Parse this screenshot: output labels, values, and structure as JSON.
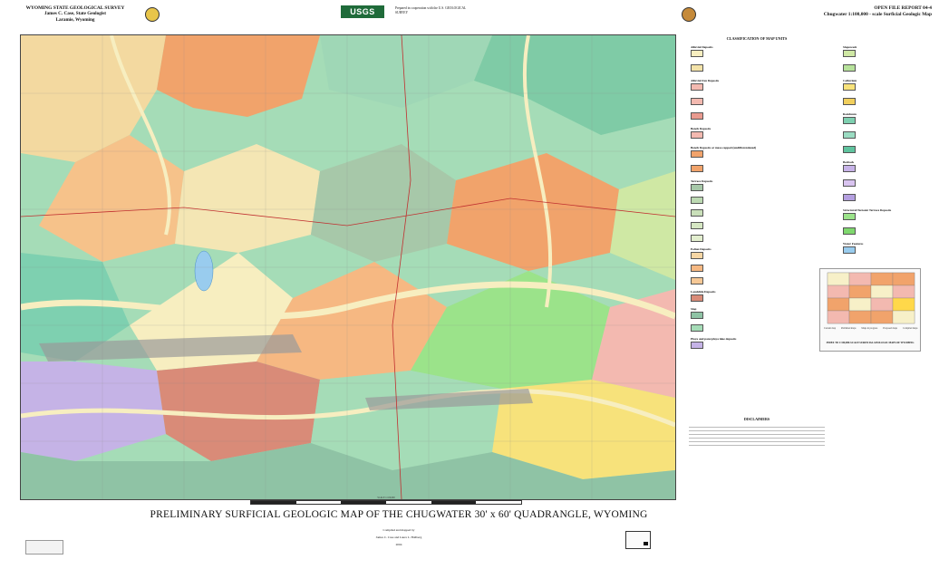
{
  "header": {
    "left_lines": [
      "WYOMING STATE GEOLOGICAL SURVEY",
      "James C. Case, State Geologist",
      "Laramie, Wyoming"
    ],
    "usgs_logo_text": "USGS",
    "coop_text": "Prepared in cooperation with the U.S. GEOLOGICAL SURVEY",
    "right_lines": [
      "OPEN FILE REPORT 04-4",
      "Chugwater 1:100,000 - scale Surficial Geologic Map"
    ]
  },
  "legend": {
    "title": "CLASSIFICATION OF MAP UNITS",
    "sections_left": [
      "Alluvial Deposits",
      "Alluvial Fan Deposits",
      "Bench Deposits",
      "Bench Deposits or mesa capped (undifferentiated)",
      "Terrace Deposits",
      "Eolian Deposits",
      "Landslide Deposits",
      "Slop",
      "Playa and pans/playa lake deposits"
    ],
    "sections_right": [
      "Slopewash",
      "Colluvium",
      "Residuum",
      "Bedrock",
      "Structural/Tectonic Terrace Deposits",
      "Water Features"
    ],
    "colors": {
      "alluvial": "#f7eec0",
      "fan": "#f3b9b0",
      "bench": "#f1a36b",
      "terrace": "#a7c8a9",
      "eolian": "#f6b882",
      "landslide": "#d98b78",
      "slop": "#8fc3a5",
      "playa": "#c5b3e6",
      "slopewash": "#cfe8a4",
      "colluvium": "#f7e27b",
      "residuum": "#7ed0b0",
      "bedrock": "#c7b3e8",
      "structural": "#9be38a",
      "water": "#99ccee"
    }
  },
  "index_map": {
    "title": "INDEX TO 1:100,000-SCALE SURFICIAL GEOLOGIC MAPS OF WYOMING",
    "key": [
      "Current map",
      "Published maps",
      "Maps in progress",
      "Proposed maps",
      "Compiled maps"
    ]
  },
  "title": {
    "main": "PRELIMINARY SURFICIAL GEOLOGIC MAP OF THE CHUGWATER 30' x 60' QUADRANGLE, WYOMING",
    "compiled": "Compiled and mapped by",
    "authors": "James C. Case and Laura L. Hallberg",
    "year": "2004"
  },
  "scale": {
    "label": "SCALE 1:100,000"
  },
  "disclaimers": {
    "title": "DISCLAIMERS"
  }
}
